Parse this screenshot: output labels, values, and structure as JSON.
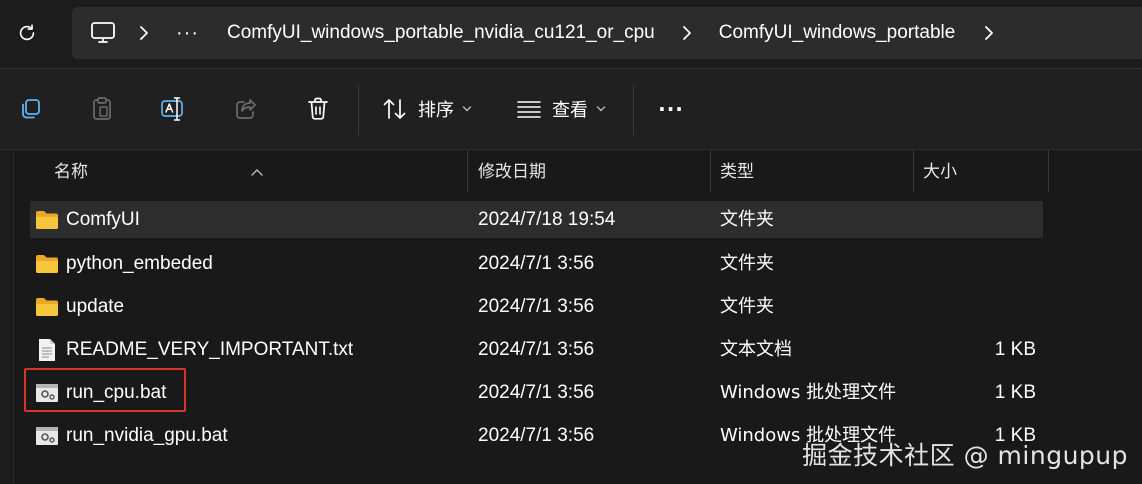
{
  "address_bar": {
    "crumbs": [
      "ComfyUI_windows_portable_nvidia_cu121_or_cpu",
      "ComfyUI_windows_portable"
    ],
    "overflow": "···"
  },
  "toolbar": {
    "sort_label": "排序",
    "view_label": "查看",
    "more": "···"
  },
  "columns": {
    "name": "名称",
    "date": "修改日期",
    "type": "类型",
    "size": "大小"
  },
  "files": [
    {
      "name": "ComfyUI",
      "date": "2024/7/18 19:54",
      "type": "文件夹",
      "size": "",
      "icon": "folder-icon"
    },
    {
      "name": "python_embeded",
      "date": "2024/7/1 3:56",
      "type": "文件夹",
      "size": "",
      "icon": "folder-icon"
    },
    {
      "name": "update",
      "date": "2024/7/1 3:56",
      "type": "文件夹",
      "size": "",
      "icon": "folder-icon"
    },
    {
      "name": "README_VERY_IMPORTANT.txt",
      "date": "2024/7/1 3:56",
      "type": "文本文档",
      "size": "1 KB",
      "icon": "text-file-icon"
    },
    {
      "name": "run_cpu.bat",
      "date": "2024/7/1 3:56",
      "type": "Windows 批处理文件",
      "size": "1 KB",
      "icon": "batch-file-icon"
    },
    {
      "name": "run_nvidia_gpu.bat",
      "date": "2024/7/1 3:56",
      "type": "Windows 批处理文件",
      "size": "1 KB",
      "icon": "batch-file-icon"
    }
  ],
  "watermark": "掘金技术社区 @ mingupup",
  "colors": {
    "background": "#191919",
    "folder": "#f8c63d",
    "highlight": "#d9342b",
    "selected_row": "#2d2d2d"
  }
}
